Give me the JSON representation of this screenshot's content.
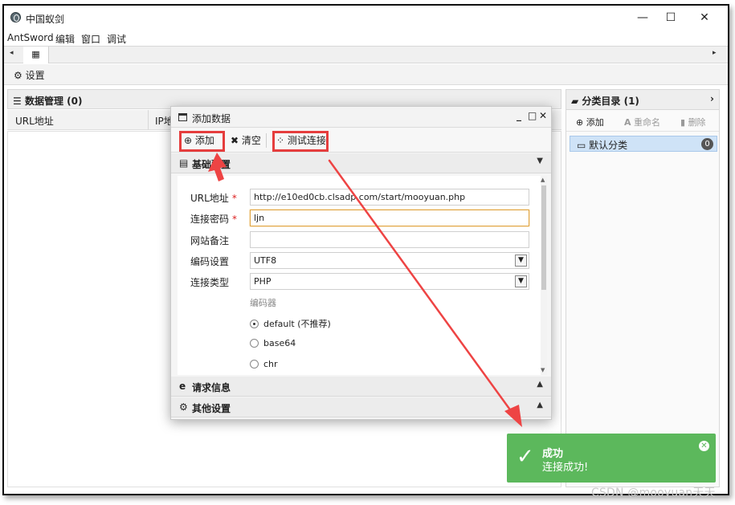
{
  "window": {
    "title": "中国蚁剑",
    "minimize": "—",
    "maximize": "☐",
    "close": "✕"
  },
  "menu": [
    "AntSword",
    "编辑",
    "窗口",
    "调试"
  ],
  "tabs": {
    "left_arrow": "◂",
    "right_arrow": "▸",
    "home_icon": "▦"
  },
  "settings": {
    "label": "设置",
    "icon": "⚙"
  },
  "data_panel": {
    "header": "数据管理 (0)",
    "columns": [
      "URL地址",
      "IP地"
    ]
  },
  "category_panel": {
    "header": "分类目录 (1)",
    "add": "添加",
    "rename": "重命名",
    "delete": "删除",
    "items": [
      {
        "label": "默认分类",
        "count": "0"
      }
    ]
  },
  "dialog": {
    "title": "添加数据",
    "toolbar": {
      "add": "添加",
      "clear": "清空",
      "test": "测试连接"
    },
    "section_basic": "基础配置",
    "fields": {
      "url_label": "URL地址",
      "url_value": "http://e10ed0cb.clsadp.com/start/mooyuan.php",
      "password_label": "连接密码",
      "password_value": "ljn",
      "note_label": "网站备注",
      "note_value": "",
      "encoding_label": "编码设置",
      "encoding_value": "UTF8",
      "type_label": "连接类型",
      "type_value": "PHP",
      "required_mark": "*"
    },
    "encoder": {
      "title": "编码器",
      "options": [
        {
          "label": "default (不推荐)",
          "checked": true
        },
        {
          "label": "base64",
          "checked": false
        },
        {
          "label": "chr",
          "checked": false
        }
      ]
    },
    "section_request": "请求信息",
    "section_other": "其他设置"
  },
  "toast": {
    "title": "成功",
    "message": "连接成功!"
  },
  "watermark": "CSDN @mooyuan天天",
  "colors": {
    "highlight": "#e53d3d",
    "toast": "#5cb85c",
    "focus": "#e0a542",
    "selected": "#cfe3f7"
  }
}
